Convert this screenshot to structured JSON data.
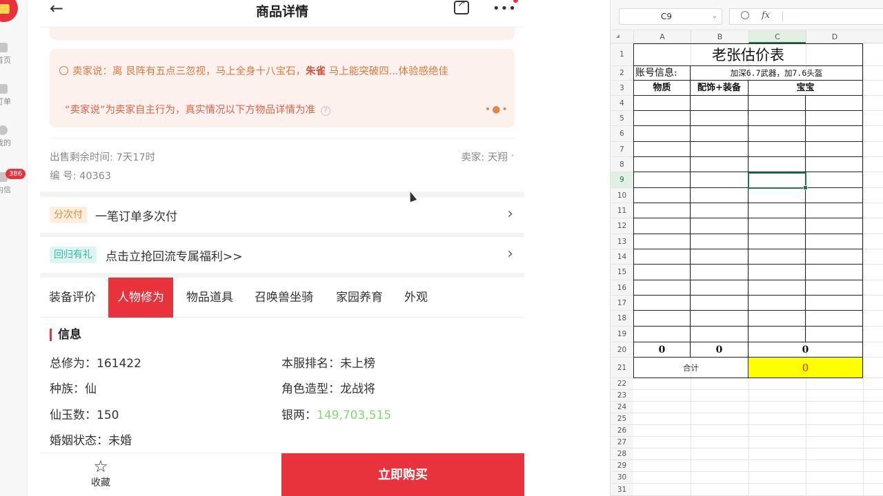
{
  "left_nav": {
    "items": [
      {
        "icon": "home-icon",
        "label": "首页"
      },
      {
        "icon": "order-icon",
        "label": "订单"
      },
      {
        "icon": "user-icon",
        "label": "我的"
      },
      {
        "icon": "message-icon",
        "label": "内信",
        "badge": "386"
      }
    ]
  },
  "app": {
    "header": {
      "back_icon": "←",
      "title": "商品详情",
      "share_icon": "share-icon",
      "more_icon": "•••"
    },
    "seller_say": {
      "prefix": "卖家说：离  艮阵有五点三忽视，马上全身十八宝石，",
      "bold": "朱雀",
      "suffix": " 马上能突破四...体验感绝佳",
      "disclaimer": "“卖家说”为卖家自主行为，真实情况以下方物品详情为准",
      "question_mark": "?",
      "dots": "•●•"
    },
    "meta": {
      "time_left": "出售剩余时间: 7天17时",
      "serial": "编 号: 40363",
      "seller": "卖家: 天翔"
    },
    "installment": {
      "tag": "分次付",
      "text": "一笔订单多次付",
      "chevron": "›"
    },
    "return_gift": {
      "tag": "回归有礼",
      "text": "点击立抢回流专属福利>>",
      "chevron": "›"
    },
    "tabs": [
      "装备评价",
      "人物修为",
      "物品道具",
      "召唤兽坐骑",
      "家园养育",
      "外观"
    ],
    "active_tab": "人物修为",
    "info": {
      "heading": "信息",
      "fields": [
        {
          "label": "总修为：",
          "value": "161422"
        },
        {
          "label": "本服排名：",
          "value": "未上榜"
        },
        {
          "label": "种族：",
          "value": "仙"
        },
        {
          "label": "角色造型：",
          "value": "龙战将"
        },
        {
          "label": "仙玉数：",
          "value": "150"
        },
        {
          "label": "银两：",
          "value": "149,703,515"
        },
        {
          "label": "婚姻状态：",
          "value": "未婚"
        }
      ],
      "silver_color": "#7fdc6a"
    },
    "bottom": {
      "favorite_label": "收藏",
      "star": "☆",
      "buy_label": "立即购买"
    },
    "accent_color": "#e8323c"
  },
  "spreadsheet": {
    "name_box": "C9",
    "fx_label": "fx",
    "columns": [
      "A",
      "B",
      "C",
      "D"
    ],
    "selected_column": "C",
    "rows": [
      "1",
      "2",
      "3",
      "4",
      "5",
      "6",
      "7",
      "8",
      "9",
      "10",
      "11",
      "12",
      "13",
      "14",
      "15",
      "16",
      "17",
      "18",
      "19",
      "20",
      "21",
      "22",
      "23",
      "24",
      "25",
      "26",
      "27",
      "28",
      "29",
      "30",
      "31"
    ],
    "selected_row": "9",
    "title": "老张估价表",
    "account_label": "账号信息:",
    "account_value": "加深6.7武器，加7.6头盔",
    "headers": [
      "物质",
      "配饰+装备",
      "宝宝"
    ],
    "sums": [
      "0",
      "0",
      "0"
    ],
    "total_label": "合计",
    "total_value": "0",
    "highlight_color": "#ffff00",
    "total_text_color": "#e41b1b",
    "selection_color": "#217346"
  }
}
